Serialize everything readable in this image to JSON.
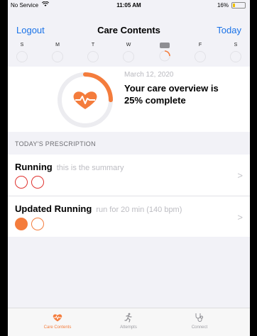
{
  "status_bar": {
    "carrier": "No Service",
    "time": "11:05 AM",
    "battery": "16%"
  },
  "nav": {
    "left": "Logout",
    "title": "Care Contents",
    "right": "Today"
  },
  "week": {
    "days": [
      "S",
      "M",
      "T",
      "W",
      "",
      "F",
      "S"
    ],
    "selected_index": 4,
    "progress_index": 4
  },
  "overview": {
    "date": "March 12, 2020",
    "summary": "Your care overview is 25% complete",
    "progress": 0.25
  },
  "section": {
    "header": "TODAY'S PRESCRIPTION"
  },
  "tasks": [
    {
      "title": "Running",
      "subtitle": "this is the summary",
      "completed": [
        false,
        false
      ]
    },
    {
      "title": "Updated Running",
      "subtitle": "run for 20 min (140 bpm)",
      "completed": [
        true,
        false
      ]
    }
  ],
  "tabs": [
    {
      "label": "Care Contents",
      "icon": "heart-icon",
      "active": true
    },
    {
      "label": "Attempts",
      "icon": "running-person-icon",
      "active": false
    },
    {
      "label": "Connect",
      "icon": "stethoscope-icon",
      "active": false
    }
  ],
  "colors": {
    "accent": "#f47c3c",
    "link": "#1a73e8",
    "incomplete": "#e0322f"
  }
}
